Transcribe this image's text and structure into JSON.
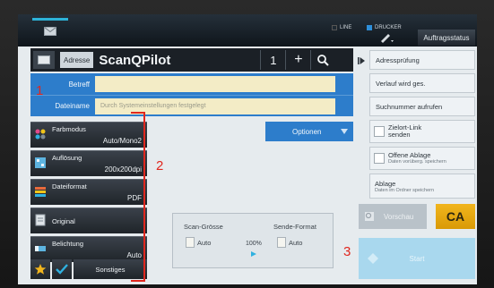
{
  "topbar": {
    "indicators": [
      {
        "label": "LINE",
        "active": false
      },
      {
        "label": "DRUCKER",
        "active": true
      }
    ],
    "status_button": "Auftragsstatus"
  },
  "address": {
    "label": "Adresse",
    "name": "ScanQPilot",
    "count": "1",
    "plus": "+"
  },
  "fields": {
    "subject_label": "Betreff",
    "subject_value": "",
    "filename_label": "Dateiname",
    "filename_placeholder": "Durch Systemeinstellungen festgelegt"
  },
  "options_label": "Optionen",
  "settings": [
    {
      "title": "Farbmodus",
      "value": "Auto/Mono2",
      "icon": "color-mode-icon"
    },
    {
      "title": "Auflösung",
      "value": "200x200dpi",
      "icon": "resolution-icon"
    },
    {
      "title": "Dateiformat",
      "value": "PDF",
      "icon": "file-format-icon"
    },
    {
      "title": "Original",
      "value": "",
      "icon": "original-icon"
    },
    {
      "title": "Belichtung",
      "value": "Auto",
      "icon": "exposure-icon"
    }
  ],
  "bottom_actions": {
    "other": "Sonstiges"
  },
  "scan_info": {
    "scan_size_label": "Scan-Grösse",
    "scan_size_value": "Auto",
    "ratio": "100%",
    "send_format_label": "Sende-Format",
    "send_format_value": "Auto"
  },
  "right_menu": {
    "address_check": "Adressprüfung",
    "history": "Verlauf wird ges.",
    "call_number": "Suchnummer aufrufen",
    "dest_link_line1": "Zielort-Link",
    "dest_link_line2": "senden",
    "open_file_title": "Offene Ablage",
    "open_file_sub": "Daten vorüberg. speichern",
    "file_title": "Ablage",
    "file_sub": "Daten im Ordner speichern"
  },
  "preview_label": "Vorschau",
  "ca_label": "CA",
  "start_label": "Start",
  "annotations": [
    "1",
    "2",
    "3"
  ],
  "colors": {
    "accent_blue": "#2d7dcb",
    "input_yellow": "#f3ecc6",
    "ca_yellow": "#f1b51d",
    "annotation_red": "#e0271e"
  }
}
